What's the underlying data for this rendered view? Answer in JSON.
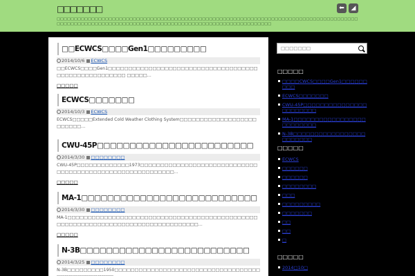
{
  "header": {
    "site_title": "□□□□□□□",
    "site_description": "□□□□□□□□□□□□□□□□□□□□□□□□□□□□□□□□□□□□□□□□□□□□□□□□□□□□□□□□□□□□□□□□□□□□□□□□□□□□□□□□□□□□□□□□□□□□□□□□□□□□□□□□□□□□□□□□□□□□□□□□□□□□□□□□□□□□□□□□□□□□□□□□□□□□□",
    "share_icon": "share-icon",
    "rss_icon": "rss-icon"
  },
  "posts": [
    {
      "title": "□□ECWCS□□□□Gen1□□□□□□□□□",
      "date": "2014/10/6",
      "category": "ECWCS",
      "excerpt": "□□ECWCS□□□□Gen1□□□□□□□□□□□□□□□□□□□□□□□□□□□□□□□□□□□□□□□□□□□□□□□□□□□□□□ □□□□□…",
      "more": "□□□□□"
    },
    {
      "title": "ECWCS□□□□□□□",
      "date": "2014/10/3",
      "category": "ECWCS",
      "excerpt": "ECWCS□□□□□Extended Cold Weather Clothing System□□□□□□□□□□□□□□□□□□□□□□□□□…",
      "more": ""
    },
    {
      "title": "CWU-45P□□□□□□□□□□□□□□□□□□□□□□□□",
      "date": "2014/3/30",
      "category": "□□□□□□□□",
      "excerpt": "CWU-45P□□□□□□□□□□□□□1973□□□□□□□□□□□□□□□□□□□□□□□□□□□□□□□□□□□□□□□□□□□□□□□□□□□□□□□□□□…",
      "more": "□□□□□"
    },
    {
      "title": "MA-1□□□□□□□□□□□□□□□□□□□□□□□□□□□",
      "date": "2014/3/30",
      "category": "□□□□□□□□",
      "excerpt": "MA-1□□□□□□□□□□□□□□□□□□□□□□□□□□□□□□□□□□□□□□□□□□□□□□□□□□□□□□□□□□□□□□□□□□□□□□□□□□□□□□□□□□…",
      "more": "□□□□□"
    },
    {
      "title": "N-3B□□□□□□□□□□□□□□□□□□□□□□□□□□",
      "date": "2014/3/25",
      "category": "□□□□□□□□",
      "excerpt": "N-3B□□□□□□□□□1950□□□□□□□□□□□□□□□□□□□□□□□□□□□□□□□□□□□□□□□□□□□□□□□□□□",
      "more": ""
    }
  ],
  "sidebar": {
    "search_placeholder": "□□□□□□□",
    "recent_title": "□□□□□",
    "recent_posts": [
      "□□□□CWCS□□□□Gen1□□□□□□□□□",
      "ECWCS□□□□□□□",
      "CWU-45P□□□□□□□□□□□□□□□□□□□□□□□",
      "MA-1□□□□□□□□□□□□□□□□□□□□□□□□□",
      "N-3B□□□□□□□□□□□□□□□□□□□□□□□□"
    ],
    "categories_title": "□□□□□",
    "categories": [
      "ECWCS",
      "□□□□□□",
      "□□□□□□",
      "□□□□□□□□",
      "□□□",
      "□□□□□□□□□",
      "□□□□□□□",
      "□□",
      "□□",
      "□"
    ],
    "archive_title": "□□□□□",
    "archives": [
      "2014□10□"
    ]
  },
  "colors": {
    "header_bg": "#a0db80",
    "page_bg": "#000000",
    "link": "#2a3fd6"
  }
}
